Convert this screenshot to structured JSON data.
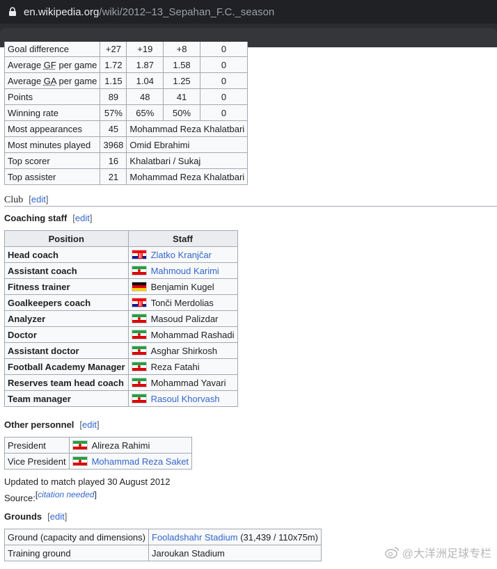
{
  "browser": {
    "url_host": "en.wikipedia.org",
    "url_path": "/wiki/2012–13_Sepahan_F.C._season"
  },
  "stats_table": {
    "rows": [
      {
        "label": "Goal difference",
        "c1": "+27",
        "c2": "+19",
        "c3": "+8",
        "c4": "0"
      },
      {
        "label_pre": "Average ",
        "label_abbr": "GF",
        "label_post": " per game",
        "c1": "1.72",
        "c2": "1.87",
        "c3": "1.58",
        "c4": "0"
      },
      {
        "label_pre": "Average ",
        "label_abbr": "GA",
        "label_post": " per game",
        "c1": "1.15",
        "c2": "1.04",
        "c3": "1.25",
        "c4": "0"
      },
      {
        "label": "Points",
        "c1": "89",
        "c2": "48",
        "c3": "41",
        "c4": "0"
      },
      {
        "label": "Winning rate",
        "c1": "57%",
        "c2": "65%",
        "c3": "50%",
        "c4": "0"
      },
      {
        "label": "Most appearances",
        "c1": "45",
        "wide": "Mohammad Reza Khalatbari"
      },
      {
        "label": "Most minutes played",
        "c1": "3968",
        "wide": "Omid Ebrahimi"
      },
      {
        "label": "Top scorer",
        "c1": "16",
        "wide": "Khalatbari / Sukaj"
      },
      {
        "label": "Top assister",
        "c1": "21",
        "wide": "Mohammad Reza Khalatbari"
      }
    ]
  },
  "club_heading": {
    "title": "Club",
    "edit": "edit"
  },
  "coaching": {
    "title": "Coaching staff",
    "edit": "edit",
    "col_position": "Position",
    "col_staff": "Staff",
    "rows": [
      {
        "position": "Head coach",
        "flag": "croatia",
        "name": "Zlatko Kranjčar",
        "link": true
      },
      {
        "position": "Assistant coach",
        "flag": "iran",
        "name": "Mahmoud Karimi",
        "link": true
      },
      {
        "position": "Fitness trainer",
        "flag": "germany",
        "name": "Benjamin Kugel",
        "link": false
      },
      {
        "position": "Goalkeepers coach",
        "flag": "croatia",
        "name": "Tonči Merdolias",
        "link": false
      },
      {
        "position": "Analyzer",
        "flag": "iran",
        "name": "Masoud Palizdar",
        "link": false
      },
      {
        "position": "Doctor",
        "flag": "iran",
        "name": "Mohammad Rashadi",
        "link": false
      },
      {
        "position": "Assistant doctor",
        "flag": "iran",
        "name": "Asghar Shirkosh",
        "link": false
      },
      {
        "position": "Football Academy Manager",
        "flag": "iran",
        "name": "Reza Fatahi",
        "link": false
      },
      {
        "position": "Reserves team head coach",
        "flag": "iran",
        "name": "Mohammad Yavari",
        "link": false
      },
      {
        "position": "Team manager",
        "flag": "iran",
        "name": "Rasoul Khorvash",
        "link": true
      }
    ]
  },
  "other": {
    "title": "Other personnel",
    "edit": "edit",
    "rows": [
      {
        "role": "President",
        "flag": "iran",
        "name": "Alireza Rahimi",
        "link": false
      },
      {
        "role": "Vice President",
        "flag": "iran",
        "name": "Mohammad Reza Saket",
        "link": true
      }
    ],
    "updated": "Updated to match played 30 August 2012",
    "source_label": "Source:",
    "citation": "citation needed"
  },
  "grounds": {
    "title": "Grounds",
    "edit": "edit",
    "rows": [
      {
        "label": "Ground (capacity and dimensions)",
        "link_text": "Fooladshahr Stadium",
        "extra": " (31,439 / 110x75m)"
      },
      {
        "label": "Training ground",
        "value": "Jaroukan Stadium"
      }
    ]
  },
  "watermark": {
    "text": "@大洋洲足球专栏"
  }
}
